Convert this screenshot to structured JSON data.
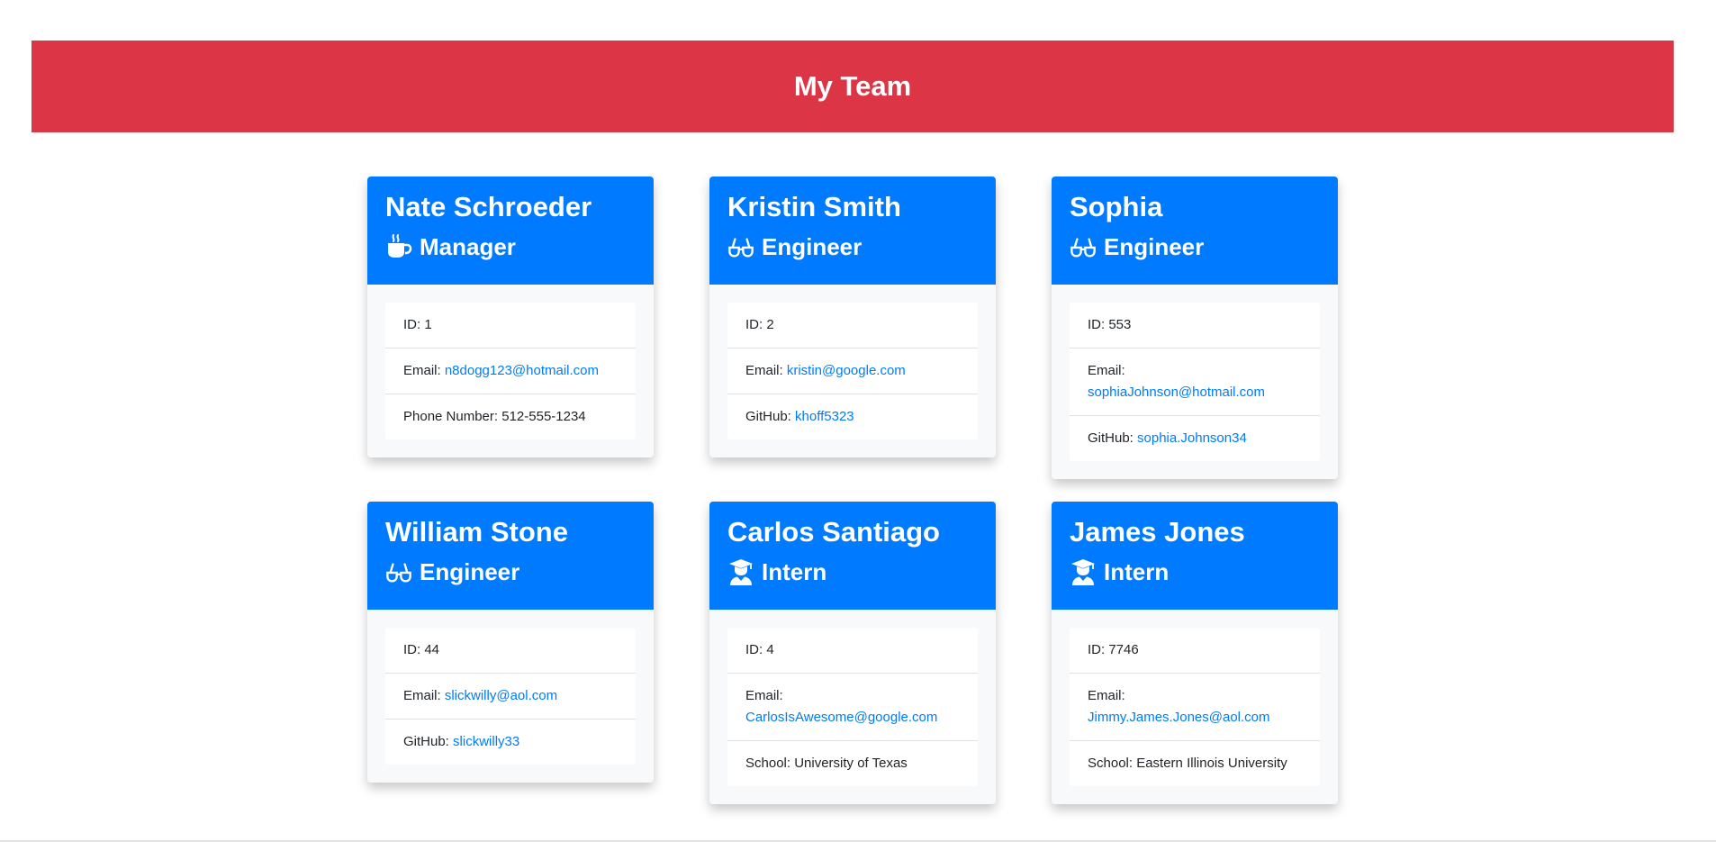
{
  "header": {
    "title": "My Team"
  },
  "roles": {
    "manager": {
      "label": "Manager",
      "icon": "coffee-mug-icon"
    },
    "engineer": {
      "label": "Engineer",
      "icon": "glasses-icon"
    },
    "intern": {
      "label": "Intern",
      "icon": "graduate-icon"
    }
  },
  "labels": {
    "id": "ID: ",
    "email": "Email: ",
    "phone": "Phone Number: ",
    "github": "GitHub: ",
    "school": "School: "
  },
  "employees": [
    {
      "name": "Nate Schroeder",
      "role": "Manager",
      "id": "1",
      "email": "n8dogg123@hotmail.com",
      "phone": "512-555-1234"
    },
    {
      "name": "Kristin Smith",
      "role": "Engineer",
      "id": "2",
      "email": "kristin@google.com",
      "github": "khoff5323"
    },
    {
      "name": "Sophia",
      "role": "Engineer",
      "id": "553",
      "email": "sophiaJohnson@hotmail.com",
      "github": "sophia.Johnson34"
    },
    {
      "name": "William Stone",
      "role": "Engineer",
      "id": "44",
      "email": "slickwilly@aol.com",
      "github": "slickwilly33"
    },
    {
      "name": "Carlos Santiago",
      "role": "Intern",
      "id": "4",
      "email": "CarlosIsAwesome@google.com",
      "school": "University of Texas"
    },
    {
      "name": "James Jones",
      "role": "Intern",
      "id": "7746",
      "email": "Jimmy.James.Jones@aol.com",
      "school": "Eastern Illinois University"
    }
  ],
  "colors": {
    "header_bg": "#dc3545",
    "card_header_bg": "#007bff",
    "link": "#007bff"
  }
}
